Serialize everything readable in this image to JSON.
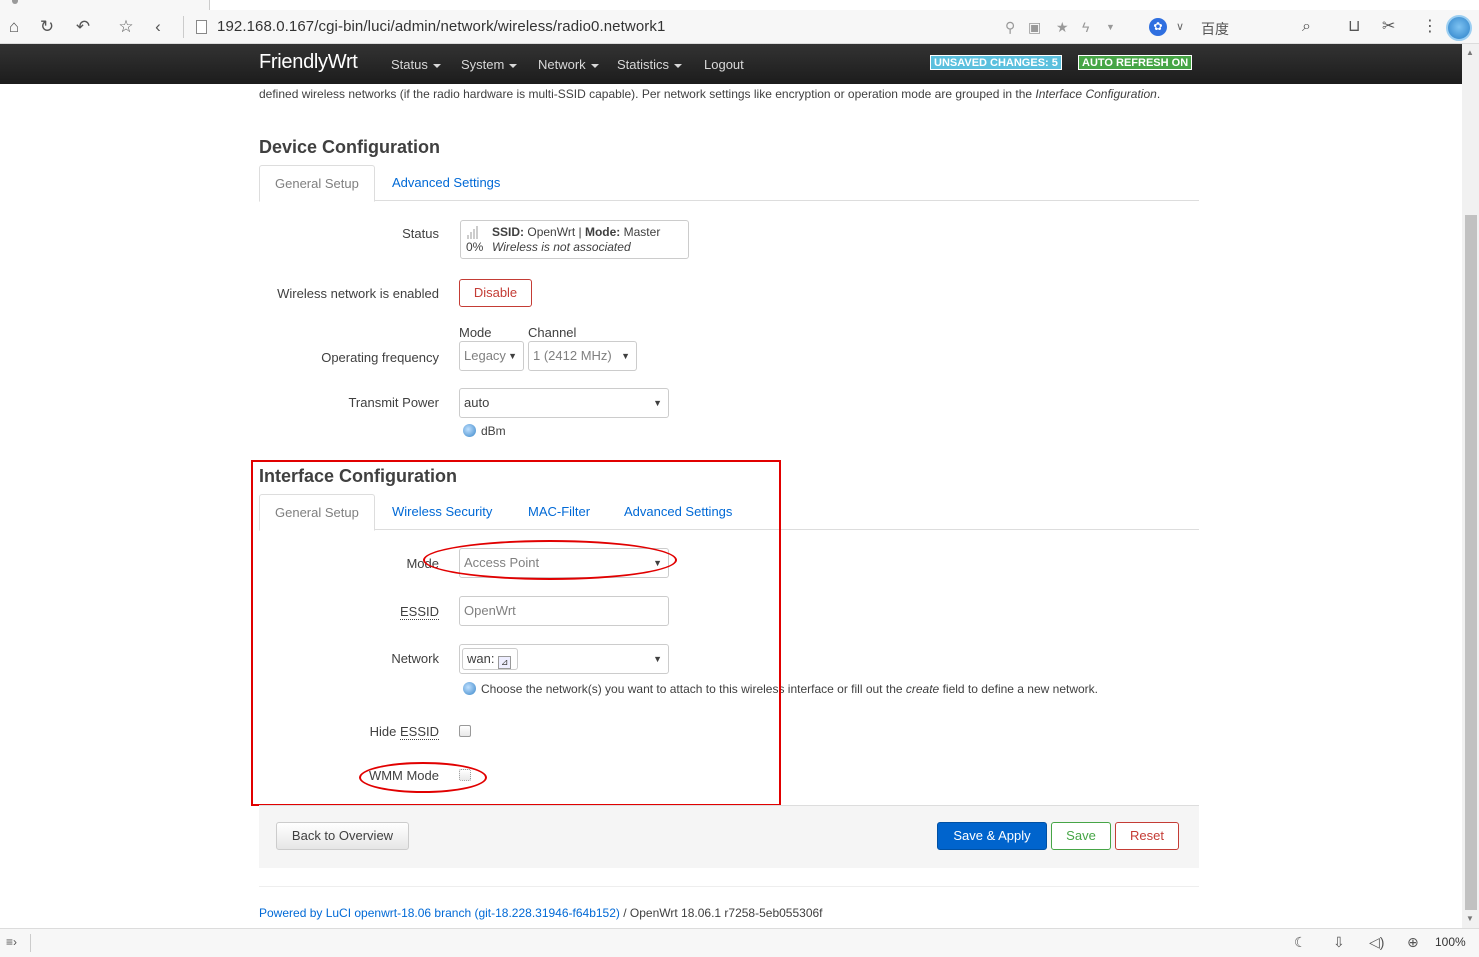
{
  "browser": {
    "url": "192.168.0.167/cgi-bin/luci/admin/network/wireless/radio0.network1",
    "search_engine": "百度",
    "zoom": "100%"
  },
  "header": {
    "brand": "FriendlyWrt",
    "menu": [
      "Status",
      "System",
      "Network",
      "Statistics",
      "Logout"
    ],
    "unsaved_badge": "UNSAVED CHANGES: 5",
    "refresh_badge": "AUTO REFRESH ON"
  },
  "intro": {
    "text_1": "defined wireless networks (if the radio hardware is multi-SSID capable). Per network settings like encryption or operation mode are grouped in the ",
    "text_em": "Interface",
    "text_2": "Configuration",
    "text_3": "."
  },
  "device": {
    "title": "Device Configuration",
    "tabs": [
      "General Setup",
      "Advanced Settings"
    ],
    "status_label": "Status",
    "status_pct": "0%",
    "status_ssid_key": "SSID:",
    "status_ssid_val": "OpenWrt",
    "status_sep": "|",
    "status_mode_key": "Mode:",
    "status_mode_val": "Master",
    "status_assoc": "Wireless is not associated",
    "enabled_label": "Wireless network is enabled",
    "disable_button": "Disable",
    "freq_label": "Operating frequency",
    "mode_col": "Mode",
    "channel_col": "Channel",
    "mode_value": "Legacy",
    "channel_value": "1 (2412 MHz)",
    "txpower_label": "Transmit Power",
    "txpower_value": "auto",
    "txpower_unit": "dBm"
  },
  "interface": {
    "title": "Interface Configuration",
    "tabs": [
      "General Setup",
      "Wireless Security",
      "MAC-Filter",
      "Advanced Settings"
    ],
    "mode_label": "Mode",
    "mode_value": "Access Point",
    "essid_label": "ESSID",
    "essid_value": "OpenWrt",
    "network_label": "Network",
    "network_value": "wan:",
    "network_help_1": "Choose the network(s) you want to attach to this wireless interface or fill out the ",
    "network_help_em": "create",
    "network_help_2": " field to define a new network.",
    "hide_essid_label_1": "Hide ",
    "hide_essid_label_2": "ESSID",
    "wmm_label": "WMM Mode"
  },
  "actions": {
    "back": "Back to Overview",
    "save_apply": "Save & Apply",
    "save": "Save",
    "reset": "Reset"
  },
  "footer": {
    "luci_link": "Powered by LuCI openwrt-18.06 branch (git-18.228.31946-f64b152)",
    "version": " / OpenWrt 18.06.1 r7258-5eb055306f"
  },
  "colors": {
    "accent": "#0069d6",
    "annotation_red": "#e10000",
    "badge_unsaved": "#5bc0de",
    "badge_refresh": "#46a546"
  },
  "icons": [
    "home-icon",
    "reload-icon",
    "undo-icon",
    "star-icon",
    "back-icon",
    "page-icon",
    "search-icon",
    "cart-icon",
    "scissors-icon",
    "more-icon",
    "help-icon",
    "night-mode-icon",
    "download-icon",
    "volume-icon",
    "zoom-icon"
  ]
}
